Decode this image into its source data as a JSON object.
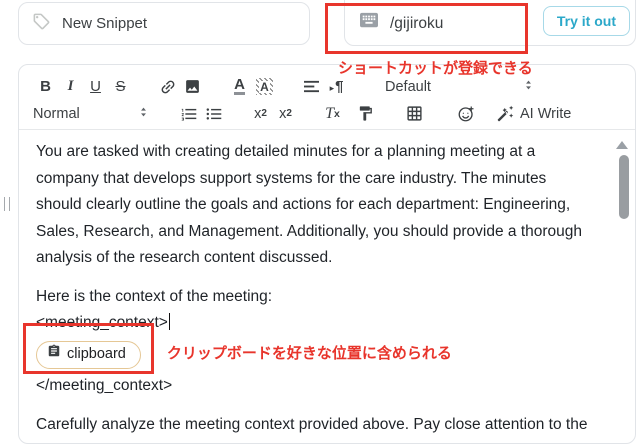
{
  "header": {
    "snippet_title": "New Snippet",
    "shortcut_value": "/gijiroku",
    "try_it_out": "Try it out"
  },
  "annotations": {
    "shortcut_note": "ショートカットが登録できる",
    "clipboard_note": "クリップボードを好きな位置に含められる"
  },
  "toolbar": {
    "bold": "B",
    "italic": "I",
    "underline": "U",
    "strikethrough": "S",
    "font_color": "A",
    "highlight": "A",
    "font_select": "Default",
    "style_select": "Normal",
    "subscript_base": "x",
    "subscript_num": "2",
    "superscript_base": "x",
    "superscript_num": "2",
    "clear_format_t": "T",
    "clear_format_x": "x",
    "ai_write": "AI Write"
  },
  "editor": {
    "paragraph1": "You are tasked with creating detailed minutes for a planning meeting at a\ncompany that develops support systems for the care industry. The minutes\nshould clearly outline the goals and actions for each department: Engineering,\nSales, Research, and Management. Additionally, you should provide a thorough\nanalysis of the research content discussed.",
    "paragraph2": "Here is the context of the meeting:",
    "meeting_open_tag": "<meeting_context>",
    "clipboard_chip": "clipboard",
    "meeting_close_tag": "</meeting_context>",
    "paragraph3": "Carefully analyze the meeting context provided above. Pay close attention to the"
  },
  "colors": {
    "annotation_red": "#e8352c",
    "try_button_cyan": "#2ba8c9",
    "chip_border_tan": "#e5c795"
  }
}
